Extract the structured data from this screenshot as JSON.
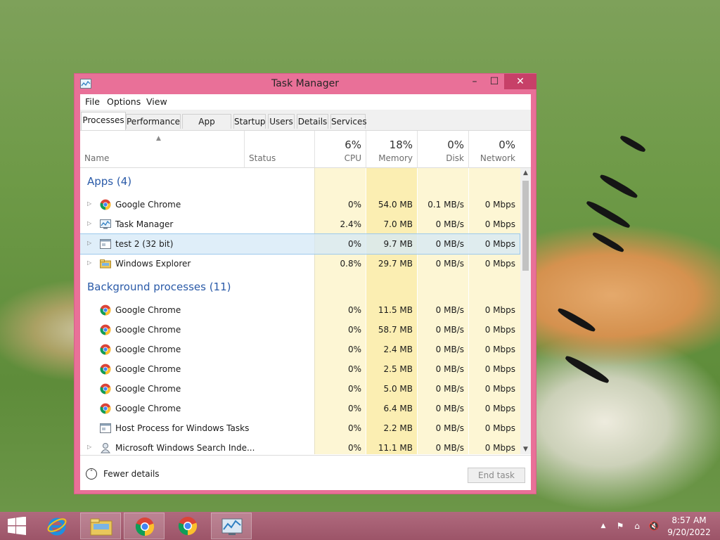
{
  "window": {
    "title": "Task Manager",
    "controls": {
      "minimize": "–",
      "maximize": "☐",
      "close": "✕"
    }
  },
  "menu": [
    "File",
    "Options",
    "View"
  ],
  "tabs": [
    "Processes",
    "Performance",
    "App history",
    "Startup",
    "Users",
    "Details",
    "Services"
  ],
  "active_tab": "Processes",
  "columns": {
    "name": "Name",
    "status": "Status",
    "cpu": {
      "label": "CPU",
      "pct": "6%"
    },
    "memory": {
      "label": "Memory",
      "pct": "18%"
    },
    "disk": {
      "label": "Disk",
      "pct": "0%"
    },
    "network": {
      "label": "Network",
      "pct": "0%"
    }
  },
  "groups": {
    "apps": {
      "title": "Apps (4)",
      "rows": [
        {
          "name": "Google Chrome",
          "icon": "chrome-icon",
          "cpu": "0%",
          "memory": "54.0 MB",
          "disk": "0.1 MB/s",
          "network": "0 Mbps"
        },
        {
          "name": "Task Manager",
          "icon": "task-manager-icon",
          "cpu": "2.4%",
          "memory": "7.0 MB",
          "disk": "0 MB/s",
          "network": "0 Mbps"
        },
        {
          "name": "test 2 (32 bit)",
          "icon": "console-window-icon",
          "cpu": "0%",
          "memory": "9.7 MB",
          "disk": "0 MB/s",
          "network": "0 Mbps"
        },
        {
          "name": "Windows Explorer",
          "icon": "folder-icon",
          "cpu": "0.8%",
          "memory": "29.7 MB",
          "disk": "0 MB/s",
          "network": "0 Mbps"
        }
      ]
    },
    "background": {
      "title": "Background processes (11)",
      "rows": [
        {
          "name": "Google Chrome",
          "icon": "chrome-icon",
          "cpu": "0%",
          "memory": "11.5 MB",
          "disk": "0 MB/s",
          "network": "0 Mbps"
        },
        {
          "name": "Google Chrome",
          "icon": "chrome-icon",
          "cpu": "0%",
          "memory": "58.7 MB",
          "disk": "0 MB/s",
          "network": "0 Mbps"
        },
        {
          "name": "Google Chrome",
          "icon": "chrome-icon",
          "cpu": "0%",
          "memory": "2.4 MB",
          "disk": "0 MB/s",
          "network": "0 Mbps"
        },
        {
          "name": "Google Chrome",
          "icon": "chrome-icon",
          "cpu": "0%",
          "memory": "2.5 MB",
          "disk": "0 MB/s",
          "network": "0 Mbps"
        },
        {
          "name": "Google Chrome",
          "icon": "chrome-icon",
          "cpu": "0%",
          "memory": "5.0 MB",
          "disk": "0 MB/s",
          "network": "0 Mbps"
        },
        {
          "name": "Google Chrome",
          "icon": "chrome-icon",
          "cpu": "0%",
          "memory": "6.4 MB",
          "disk": "0 MB/s",
          "network": "0 Mbps"
        },
        {
          "name": "Host Process for Windows Tasks",
          "icon": "console-window-icon",
          "cpu": "0%",
          "memory": "2.2 MB",
          "disk": "0 MB/s",
          "network": "0 Mbps"
        },
        {
          "name": "Microsoft Windows Search Inde...",
          "icon": "search-indexer-icon",
          "cpu": "0%",
          "memory": "11.1 MB",
          "disk": "0 MB/s",
          "network": "0 Mbps"
        }
      ]
    }
  },
  "footer": {
    "fewer_details": "Fewer details",
    "end_task": "End task"
  },
  "taskbar": {
    "items": [
      "start-icon",
      "internet-explorer-icon",
      "file-explorer-icon",
      "chrome-icon",
      "chrome-icon",
      "task-manager-icon"
    ],
    "clock_time": "8:57 AM",
    "clock_date": "9/20/2022"
  },
  "colors": {
    "window_frame": "#e97098",
    "close_button": "#c74068",
    "heat_light": "#fdf6d4",
    "heat_medium": "#fbeeb2",
    "group_title": "#2a5aa8"
  }
}
